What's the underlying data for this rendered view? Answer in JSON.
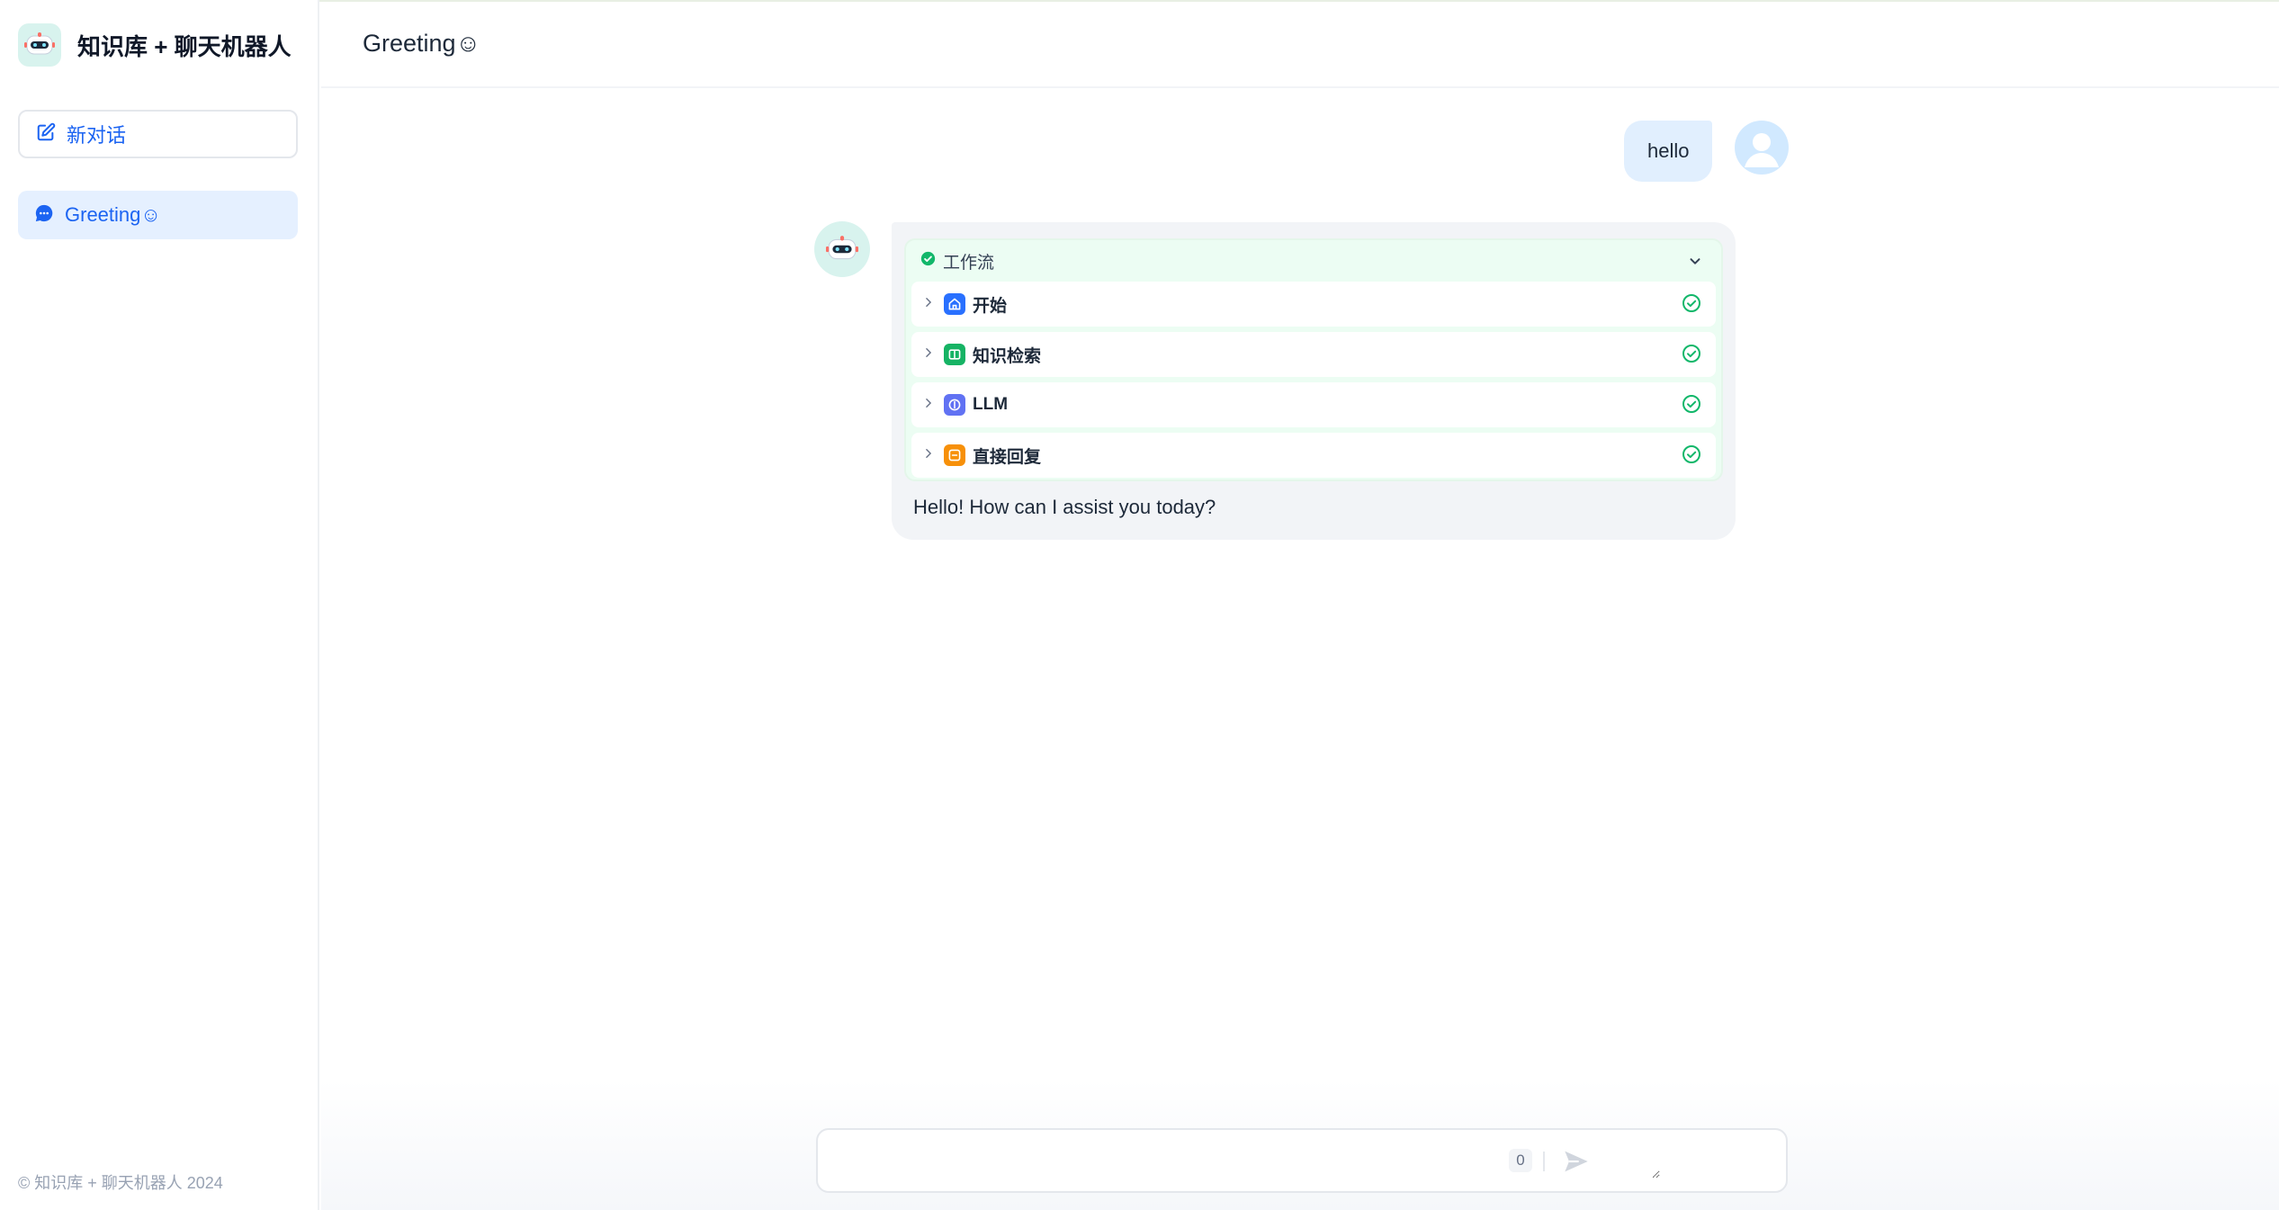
{
  "app": {
    "title": "知识库 + 聊天机器人",
    "copyright": "© 知识库 + 聊天机器人 2024"
  },
  "sidebar": {
    "new_chat_label": "新对话",
    "conversations": [
      {
        "label": "Greeting☺",
        "active": true
      }
    ]
  },
  "header": {
    "title": "Greeting☺"
  },
  "messages": {
    "user": {
      "text": "hello",
      "avatar": "user-avatar-icon"
    },
    "bot": {
      "workflow": {
        "label": "工作流",
        "status": "succeeded",
        "nodes": [
          {
            "label": "开始",
            "icon": "home-icon",
            "color": "#2970ff"
          },
          {
            "label": "知识检索",
            "icon": "book-icon",
            "color": "#16b364"
          },
          {
            "label": "LLM",
            "icon": "llm-icon",
            "color": "#6172f3"
          },
          {
            "label": "直接回复",
            "icon": "reply-icon",
            "color": "#f79009"
          }
        ]
      },
      "answer": "Hello! How can I assist you today?"
    }
  },
  "input": {
    "value": "",
    "placeholder": "",
    "char_count": "0"
  },
  "colors": {
    "accent": "#1c64f2",
    "success": "#12b76a",
    "bubble_user": "#e1effe",
    "bubble_bot": "#f2f4f7"
  }
}
